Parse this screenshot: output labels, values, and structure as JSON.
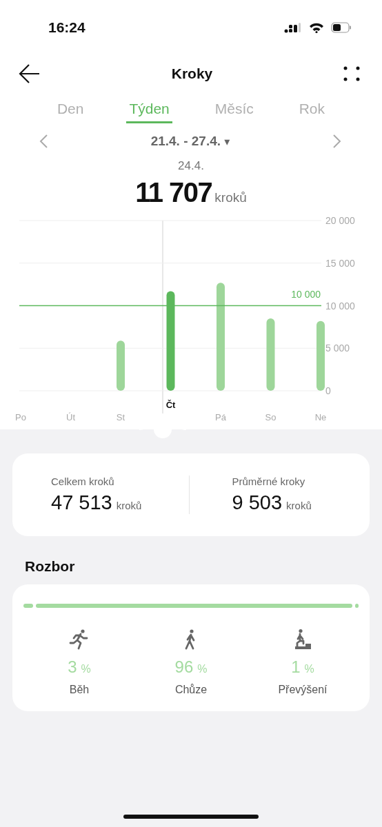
{
  "status_bar": {
    "time": "16:24"
  },
  "header": {
    "title": "Kroky"
  },
  "tabs": [
    {
      "label": "Den",
      "selected": false
    },
    {
      "label": "Týden",
      "selected": true
    },
    {
      "label": "Měsíc",
      "selected": false
    },
    {
      "label": "Rok",
      "selected": false
    }
  ],
  "period": {
    "range": "21.4. - 27.4.",
    "dropdown": "▾"
  },
  "selected_day": {
    "date": "24.4.",
    "value": "11 707",
    "unit": "kroků"
  },
  "chart": {
    "chart_data": {
      "type": "bar",
      "categories": [
        "Po",
        "Út",
        "St",
        "Čt",
        "Pá",
        "So",
        "Ne"
      ],
      "series": [
        {
          "color": "#9ed69a",
          "values": [
            0,
            0,
            5900,
            null,
            12700,
            8500,
            8200
          ]
        },
        {
          "color": "#5cb85c",
          "values": [
            null,
            null,
            null,
            11700,
            null,
            null,
            null
          ]
        }
      ],
      "ylim": [
        0,
        20000
      ],
      "grid": true,
      "yticks": [
        {
          "value": 0,
          "label": "0"
        },
        {
          "value": 5000,
          "label": "5 000"
        },
        {
          "value": 10000,
          "label": "10 000"
        },
        {
          "value": 15000,
          "label": "15 000"
        },
        {
          "value": 20000,
          "label": "20 000"
        }
      ]
    },
    "goal": {
      "label": "10 000"
    }
  },
  "summary": [
    {
      "label": "Celkem kroků",
      "value": "47 513",
      "unit": "kroků"
    },
    {
      "label": "Průměrné kroky",
      "value": "9 503",
      "unit": "kroků"
    }
  ],
  "analysis": {
    "title": "Rozbor",
    "items": [
      {
        "kind": "run",
        "value": "3",
        "unit": "%",
        "label": "Běh"
      },
      {
        "kind": "walk",
        "value": "96",
        "unit": "%",
        "label": "Chůze"
      },
      {
        "kind": "climb",
        "value": "1",
        "unit": "%",
        "label": "Převýšení"
      }
    ]
  }
}
